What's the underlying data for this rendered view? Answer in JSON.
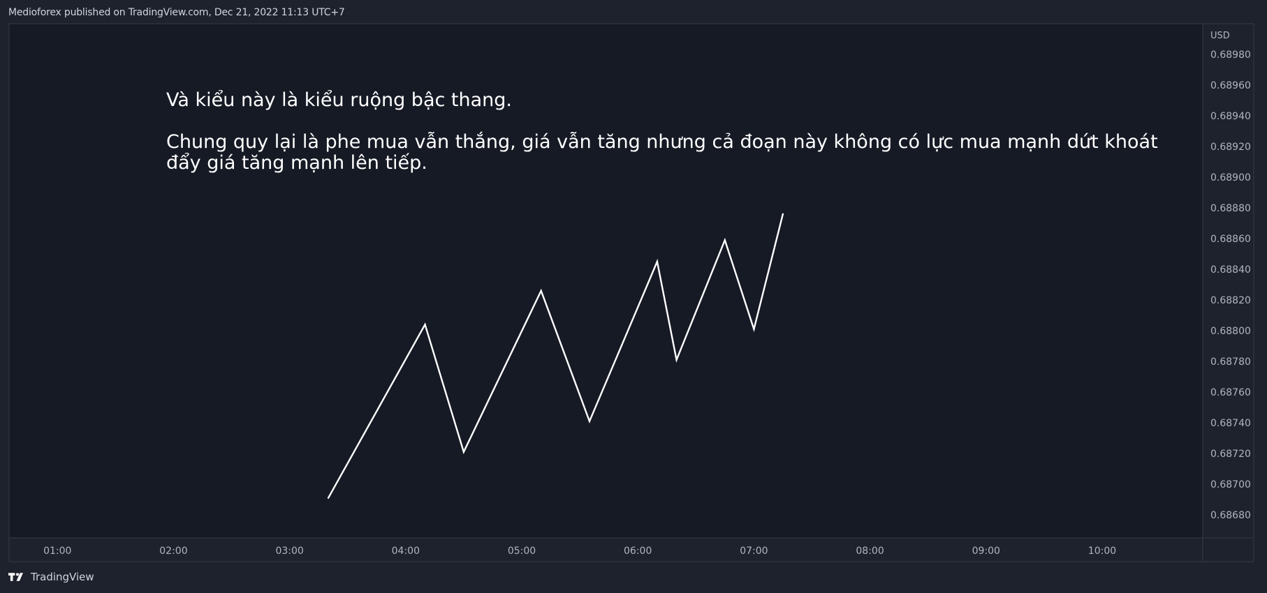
{
  "header": {
    "attribution": "Medioforex published on TradingView.com, Dec 21, 2022 11:13 UTC+7"
  },
  "footer": {
    "brand": "TradingView",
    "logo_icon": "tradingview-logo-icon"
  },
  "colors": {
    "background": "#1e222d",
    "pane": "#161a25",
    "border": "#363a45",
    "text": "#d1d4dc",
    "line": "#ffffff"
  },
  "chart_data": {
    "type": "line",
    "currency_label": "USD",
    "series": [
      {
        "x": [
          "03:20",
          "04:10",
          "04:30",
          "05:10",
          "05:35",
          "06:10",
          "06:20",
          "06:45",
          "07:00",
          "07:15"
        ],
        "values": [
          0.68691,
          0.68804,
          0.68721,
          0.68826,
          0.68741,
          0.68845,
          0.68781,
          0.68859,
          0.68801,
          0.68876
        ]
      }
    ],
    "y_ticks": [
      "0.68980",
      "0.68960",
      "0.68940",
      "0.68920",
      "0.68900",
      "0.68880",
      "0.68860",
      "0.68840",
      "0.68820",
      "0.68800",
      "0.68780",
      "0.68760",
      "0.68740",
      "0.68720",
      "0.68700",
      "0.68680"
    ],
    "x_ticks": [
      "01:00",
      "02:00",
      "03:00",
      "04:00",
      "05:00",
      "06:00",
      "07:00",
      "08:00",
      "09:00",
      "10:00"
    ],
    "ylim": [
      0.68665,
      0.69
    ],
    "xlim": [
      "00:35",
      "10:52"
    ],
    "grid": false,
    "annotation": {
      "lines": [
        "Và kiểu này là kiểu ruộng bậc thang.",
        "",
        "Chung quy lại là phe mua vẫn thắng, giá vẫn tăng nhưng cả đoạn này không có lực mua mạnh dứt khoát",
        "đẩy giá tăng mạnh lên tiếp."
      ]
    }
  }
}
